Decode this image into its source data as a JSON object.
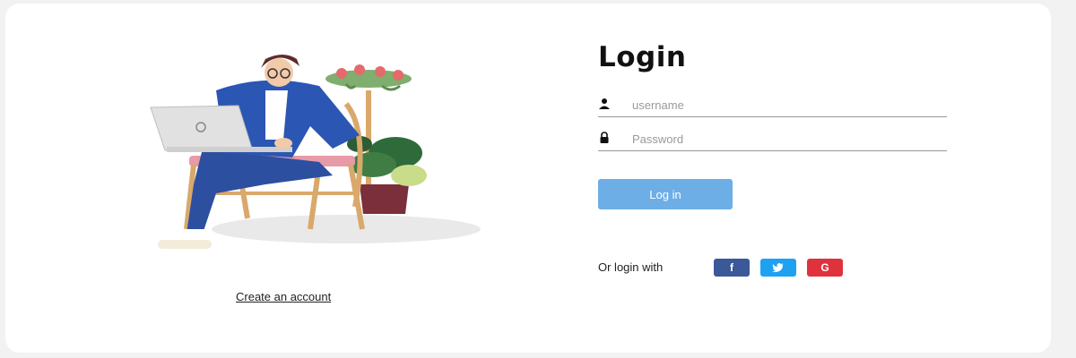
{
  "login": {
    "title": "Login",
    "username_placeholder": "username",
    "password_placeholder": "Password",
    "submit_label": "Log in"
  },
  "create_account_label": "Create an account",
  "social": {
    "label": "Or login with",
    "buttons": [
      {
        "name": "facebook",
        "glyph": "f",
        "icon": "facebook-icon",
        "color": "#3b5998"
      },
      {
        "name": "twitter",
        "glyph": "",
        "icon": "twitter-icon",
        "color": "#1da1f2"
      },
      {
        "name": "google",
        "glyph": "G",
        "icon": "google-icon",
        "color": "#e0323c"
      }
    ]
  },
  "colors": {
    "accent": "#6daee6",
    "background": "#f2f2f2",
    "card": "#ffffff"
  },
  "icons": {
    "username": "user-icon",
    "password": "lock-icon",
    "illustration": "person-with-laptop-illustration"
  }
}
